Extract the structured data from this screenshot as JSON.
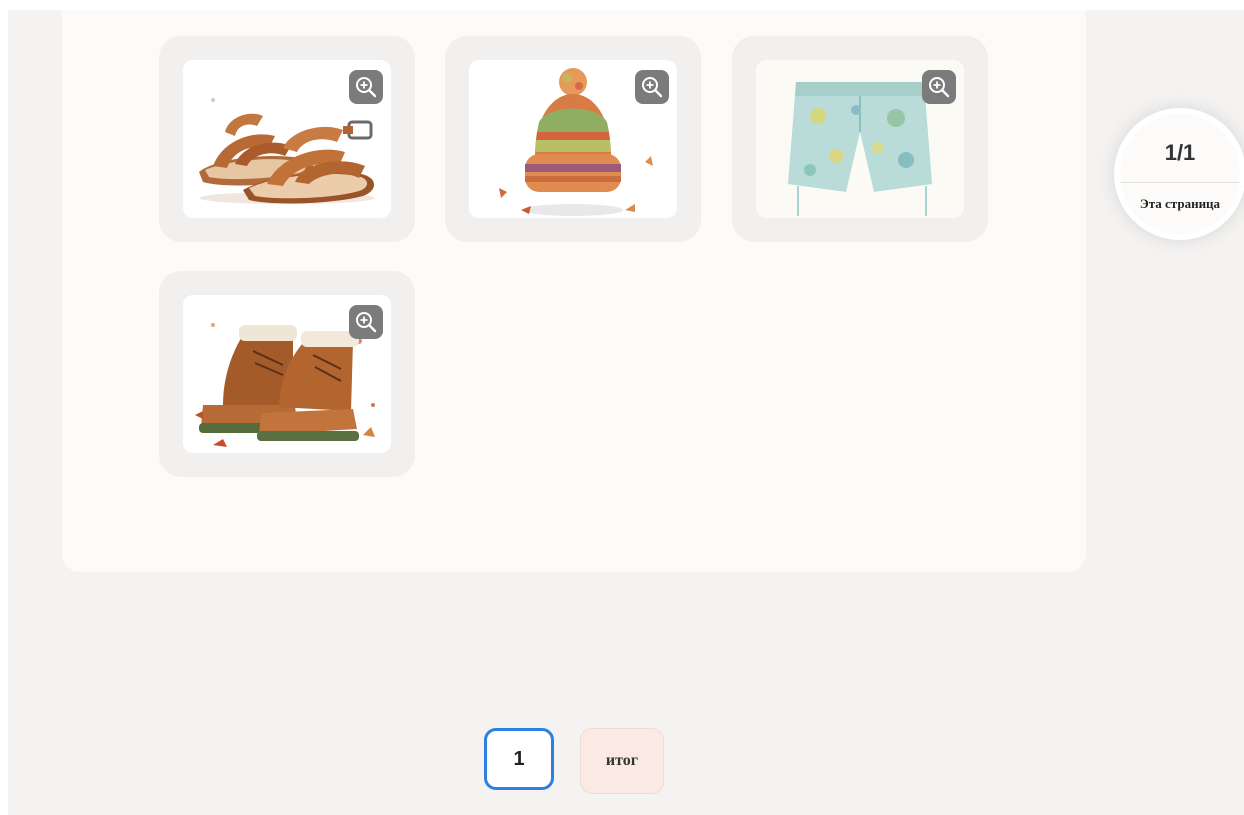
{
  "gallery": {
    "items": [
      {
        "name": "sandals",
        "zoom_icon": "zoom-in-icon"
      },
      {
        "name": "knit-hat",
        "zoom_icon": "zoom-in-icon"
      },
      {
        "name": "shorts",
        "zoom_icon": "zoom-in-icon"
      },
      {
        "name": "boots",
        "zoom_icon": "zoom-in-icon"
      }
    ]
  },
  "page_counter": {
    "value": "1/1",
    "label": "Эта страница"
  },
  "pagination": {
    "pages": [
      "1"
    ],
    "current_page": "1",
    "summary_label": "итог"
  },
  "colors": {
    "background": "#f4f3f2",
    "panel": "#fcfbfa",
    "card": "#f1f0ef",
    "active_page_border": "#2f7fe0",
    "summary_button": "#fbeae4"
  }
}
